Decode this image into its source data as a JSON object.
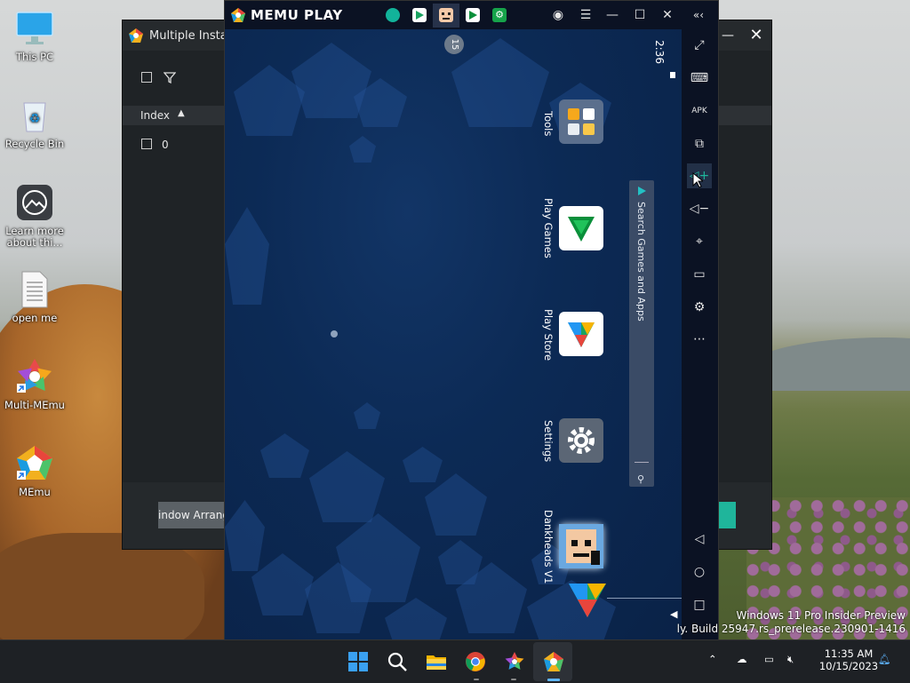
{
  "desktop": {
    "icons": [
      {
        "label": "This PC",
        "icon": "monitor-icon"
      },
      {
        "label": "Recycle Bin",
        "icon": "recycle-bin-icon"
      },
      {
        "label": "Learn more about thi...",
        "icon": "camera-circle-icon"
      },
      {
        "label": "open me",
        "icon": "text-file-icon"
      },
      {
        "label": "Multi-MEmu",
        "icon": "multi-memu-icon"
      },
      {
        "label": "MEmu",
        "icon": "memu-icon"
      }
    ],
    "watermark": {
      "line1": "Windows 11 Pro Insider Preview",
      "line2": "ly. Build 25947.rs_prerelease.230901-1416"
    }
  },
  "multi_window": {
    "title": "Multiple Instanc",
    "columns": {
      "index": "Index"
    },
    "rows": [
      {
        "index": "0"
      }
    ],
    "arrange_button": "indow Arrange",
    "close_glyph": "✕",
    "minimize_glyph": "—"
  },
  "memu": {
    "brand": "MEMU PLAY",
    "clock": "2:36",
    "status_badge": "15",
    "search_label": "Search Games and Apps",
    "apps": [
      {
        "label": "Tools",
        "icon": "tools-folder-icon"
      },
      {
        "label": "Play Games",
        "icon": "play-games-icon"
      },
      {
        "label": "Play Store",
        "icon": "play-store-icon"
      },
      {
        "label": "Settings",
        "icon": "settings-gear-icon"
      },
      {
        "label": "Dankheads V1",
        "icon": "dankheads-icon"
      }
    ],
    "sidebar_icons": [
      "fullscreen-icon",
      "keyboard-icon",
      "apk-icon",
      "multi-window-icon",
      "volume-up-icon",
      "volume-down-icon",
      "location-icon",
      "folder-icon",
      "gear-icon",
      "more-icon",
      "back-icon",
      "home-icon",
      "recents-icon"
    ],
    "colors": {
      "accent": "#1fb59b",
      "dark": "#0b1223"
    }
  },
  "taskbar": {
    "time": "11:35 AM",
    "date": "10/15/2023"
  }
}
